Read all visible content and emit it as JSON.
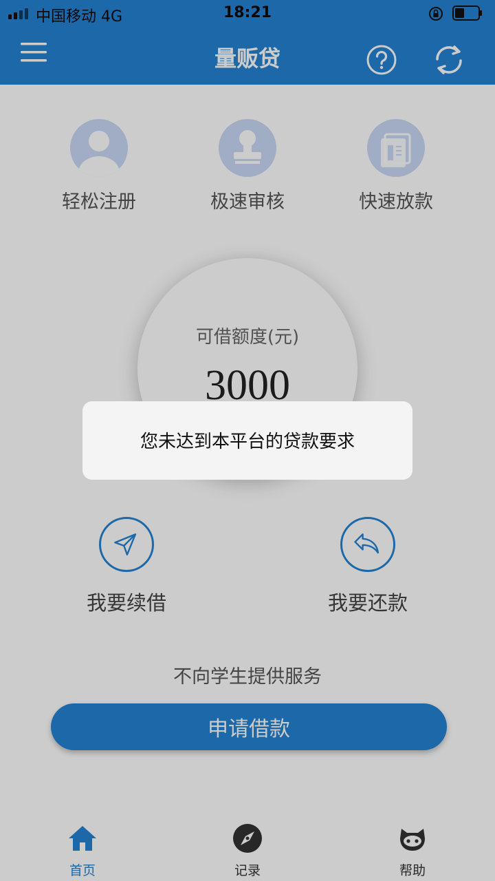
{
  "status_bar": {
    "carrier": "中国移动   4G",
    "time": "18:21"
  },
  "header": {
    "title": "量贩贷"
  },
  "features": [
    {
      "label": "轻松注册",
      "icon": "user-icon"
    },
    {
      "label": "极速审核",
      "icon": "stamp-icon"
    },
    {
      "label": "快速放款",
      "icon": "money-icon"
    }
  ],
  "quota": {
    "label": "可借额度(元)",
    "amount": "3000"
  },
  "actions": {
    "renew_label": "我要续借",
    "repay_label": "我要还款"
  },
  "notice": "不向学生提供服务",
  "apply_button": "申请借款",
  "tabs": [
    {
      "label": "首页",
      "icon": "home-icon",
      "active": true
    },
    {
      "label": "记录",
      "icon": "compass-icon",
      "active": false
    },
    {
      "label": "帮助",
      "icon": "octocat-icon",
      "active": false
    }
  ],
  "toast": {
    "message": "您未达到本平台的贷款要求"
  },
  "colors": {
    "primary": "#2383d2",
    "icon_bg": "#c9d9f6"
  }
}
